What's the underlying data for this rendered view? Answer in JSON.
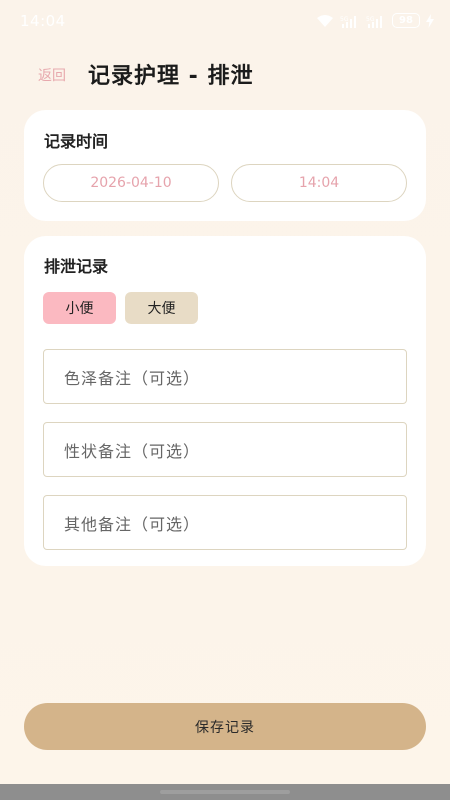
{
  "status_bar": {
    "time": "14:04",
    "battery": "98",
    "signal_label": "5G"
  },
  "header": {
    "back_label": "返回",
    "title": "记录护理 - 排泄"
  },
  "time_section": {
    "title": "记录时间",
    "date": "2026-04-10",
    "time": "14:04"
  },
  "excretion_section": {
    "title": "排泄记录",
    "types": [
      {
        "label": "小便",
        "selected": true,
        "color": "#fbb9c1"
      },
      {
        "label": "大便",
        "selected": false,
        "color": "#e8dcc6"
      }
    ],
    "color_note_placeholder": "色泽备注（可选）",
    "texture_note_placeholder": "性状备注（可选）",
    "other_note_placeholder": "其他备注（可选）"
  },
  "save_label": "保存记录",
  "colors": {
    "accent": "#d4b48a",
    "pink": "#e6a3ac"
  }
}
